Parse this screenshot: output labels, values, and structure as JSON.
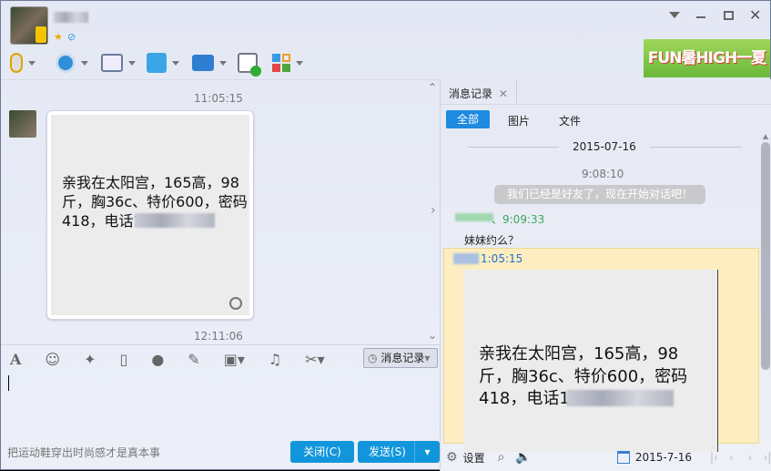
{
  "header": {
    "contact_name": "",
    "banner_text": "FUN暑HIGH一夏"
  },
  "window_controls": [
    "minimize",
    "restore",
    "maximize",
    "close"
  ],
  "toolbar": [
    "voice-call",
    "video-call",
    "screen-share",
    "file-transfer",
    "remote-assist",
    "new-group-chat",
    "apps"
  ],
  "chat": {
    "time1": "11:05:15",
    "message_lines": [
      "亲我在太阳宫，165高，98",
      "斤，胸36c、特价600，密码",
      "418，电话1"
    ],
    "time2": "12:11:06"
  },
  "input_toolbar": {
    "history_button": "消息记录"
  },
  "footer": {
    "tip": "把运动鞋穿出时尚感才是真本事",
    "close_button": "关闭(C)",
    "send_button": "发送(S)"
  },
  "history": {
    "tab_label": "消息记录",
    "filters": [
      "全部",
      "图片",
      "文件"
    ],
    "date": "2015-07-16",
    "system_time": "9:08:10",
    "system_message": "我们已经是好友了，现在开始对话吧！",
    "msg1_time": "、9:09:33",
    "msg1_text": "妹妹约么？",
    "msg2_time": "1:05:15",
    "msg2_lines": [
      "亲我在太阳宫，165高，98",
      "斤，胸36c、特价600，密码",
      "418，电话1"
    ],
    "settings_label": "设置",
    "date_picker": "2015-7-16"
  },
  "colors": {
    "accent": "#1296db",
    "green": "#3aa75a",
    "highlight": "#fdedc0"
  }
}
